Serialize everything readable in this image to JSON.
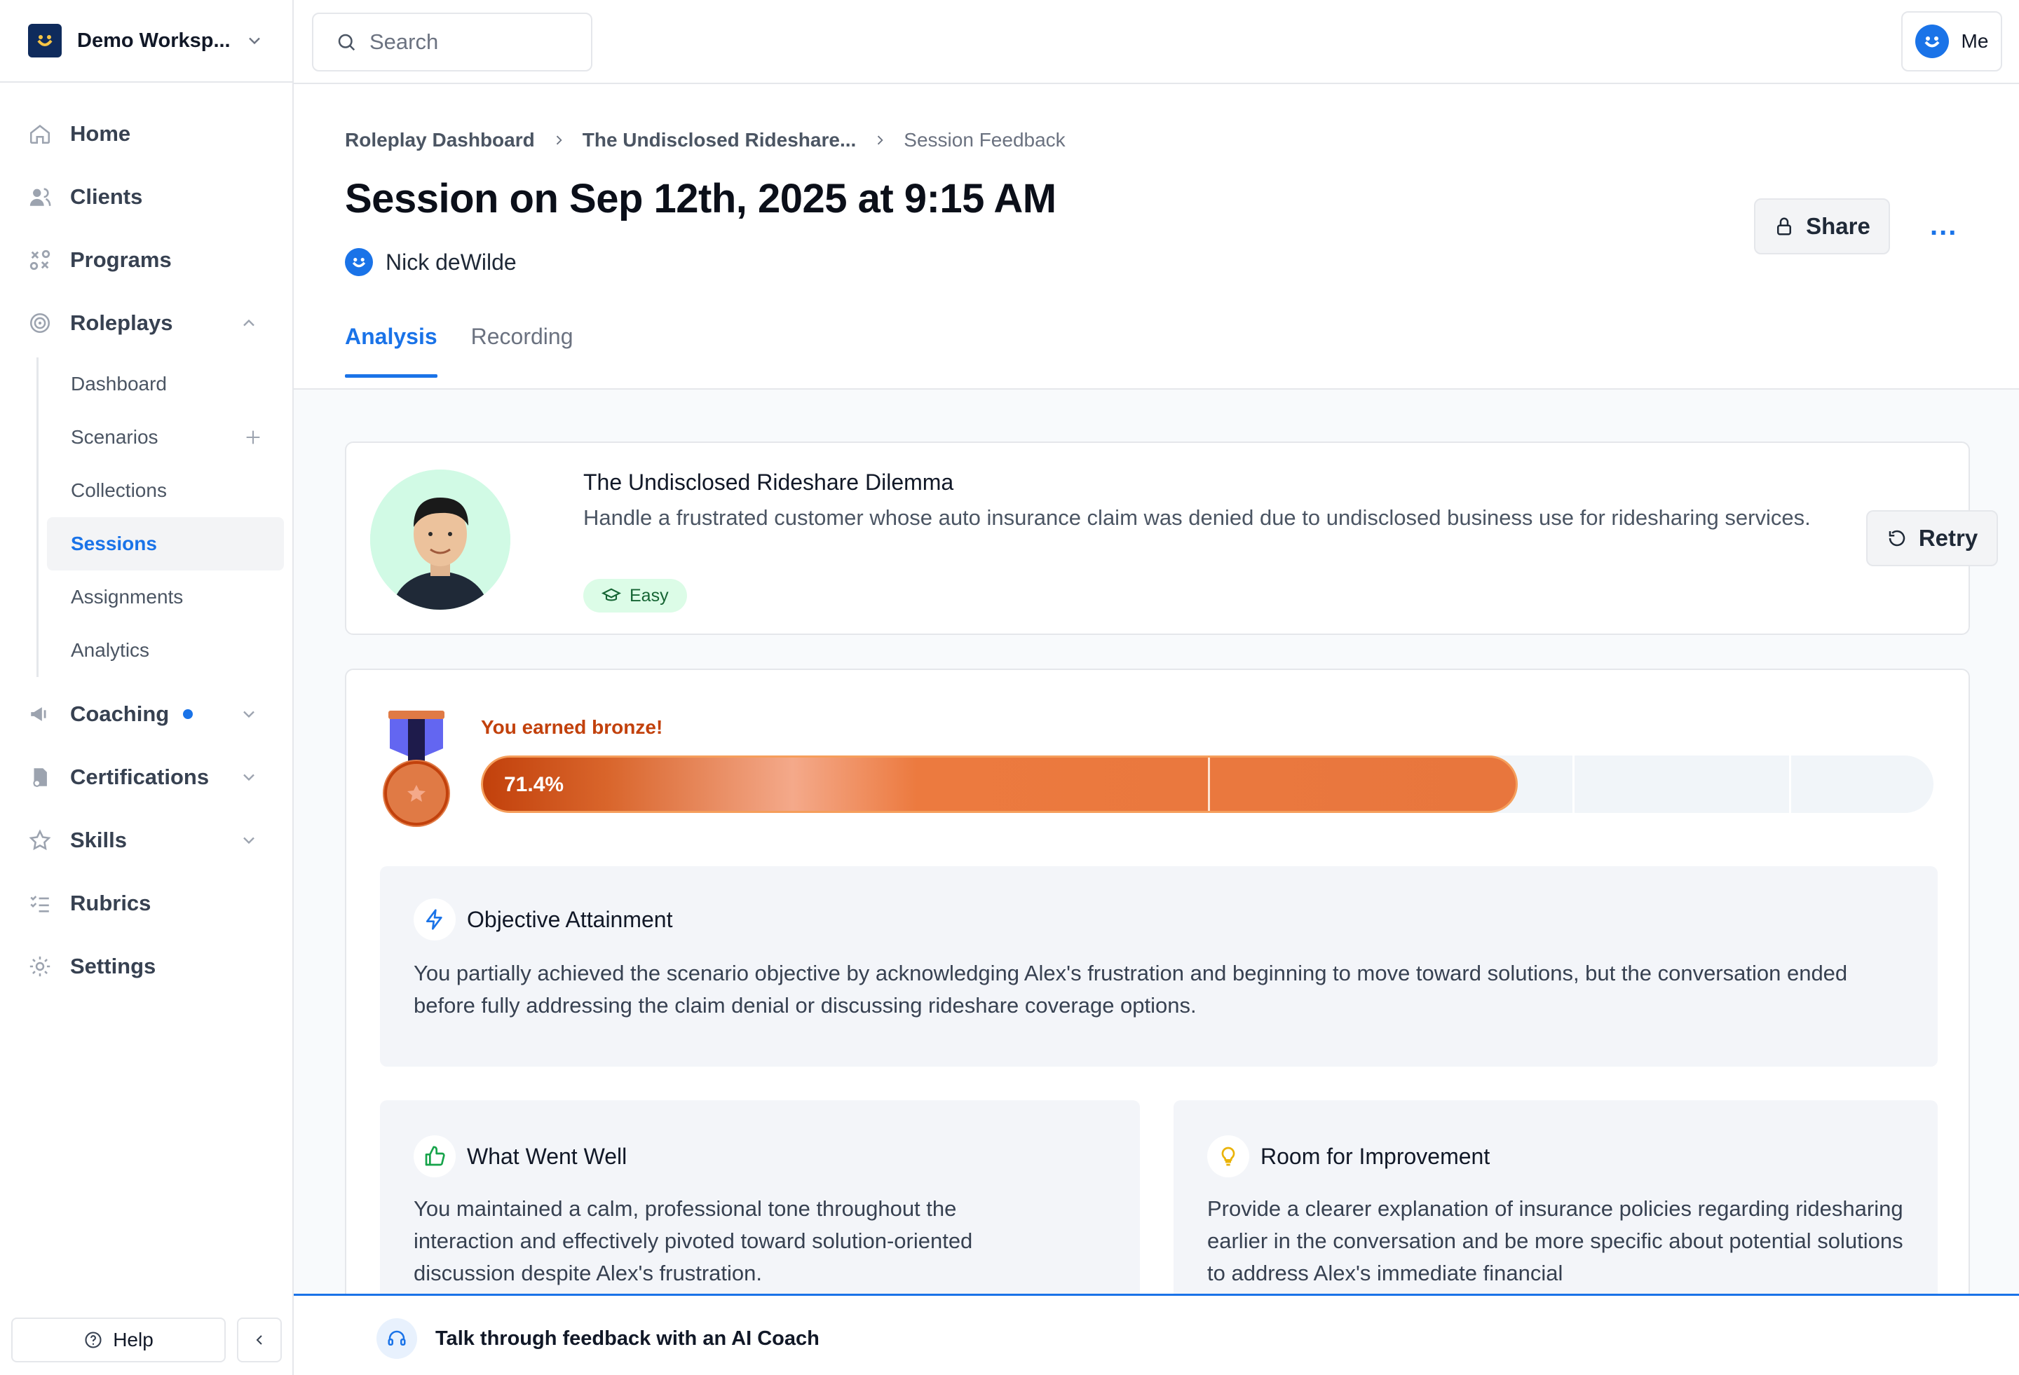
{
  "workspace": {
    "name": "Demo Worksp..."
  },
  "search": {
    "placeholder": "Search"
  },
  "user_menu": {
    "label": "Me"
  },
  "sidebar": {
    "items": [
      {
        "label": "Home",
        "icon": "home-icon"
      },
      {
        "label": "Clients",
        "icon": "clients-icon"
      },
      {
        "label": "Programs",
        "icon": "programs-icon"
      },
      {
        "label": "Roleplays",
        "icon": "target-icon",
        "expanded": true
      },
      {
        "label": "Coaching",
        "icon": "megaphone-icon",
        "notification": true
      },
      {
        "label": "Certifications",
        "icon": "certificate-icon"
      },
      {
        "label": "Skills",
        "icon": "star-icon"
      },
      {
        "label": "Rubrics",
        "icon": "checklist-icon"
      },
      {
        "label": "Settings",
        "icon": "gear-icon"
      }
    ],
    "roleplay_sub": [
      {
        "label": "Dashboard"
      },
      {
        "label": "Scenarios"
      },
      {
        "label": "Collections"
      },
      {
        "label": "Sessions",
        "active": true
      },
      {
        "label": "Assignments"
      },
      {
        "label": "Analytics"
      }
    ],
    "help_label": "Help"
  },
  "breadcrumbs": [
    "Roleplay Dashboard",
    "The Undisclosed Rideshare...",
    "Session Feedback"
  ],
  "page": {
    "title": "Session on Sep 12th, 2025 at 9:15 AM",
    "user_name": "Nick deWilde",
    "share_label": "Share",
    "more_label": "..."
  },
  "tabs": [
    {
      "label": "Analysis",
      "active": true
    },
    {
      "label": "Recording"
    }
  ],
  "scenario": {
    "title": "The Undisclosed Rideshare Dilemma",
    "description": "Handle a frustrated customer whose auto insurance claim was denied due to undisclosed business use for ridesharing services.",
    "difficulty": "Easy",
    "retry_label": "Retry"
  },
  "score": {
    "earned_text": "You earned bronze!",
    "percent_label": "71.4%",
    "percent_value": 71.4,
    "medal_color": "#e07a45"
  },
  "objective": {
    "title": "Objective Attainment",
    "body": "You partially achieved the scenario objective by acknowledging Alex's frustration and beginning to move toward solutions, but the conversation ended before fully addressing the claim denial or discussing rideshare coverage options."
  },
  "went_well": {
    "title": "What Went Well",
    "body": "You maintained a calm, professional tone throughout the interaction and effectively pivoted toward solution-oriented discussion despite Alex's frustration."
  },
  "improvement": {
    "title": "Room for Improvement",
    "body": "Provide a clearer explanation of insurance policies regarding ridesharing earlier in the conversation and be more specific about potential solutions to address Alex's immediate financial"
  },
  "coach_bar": {
    "label": "Talk through feedback with an AI Coach"
  },
  "colors": {
    "accent": "#1a73e8",
    "bronze": "#c2410c"
  }
}
